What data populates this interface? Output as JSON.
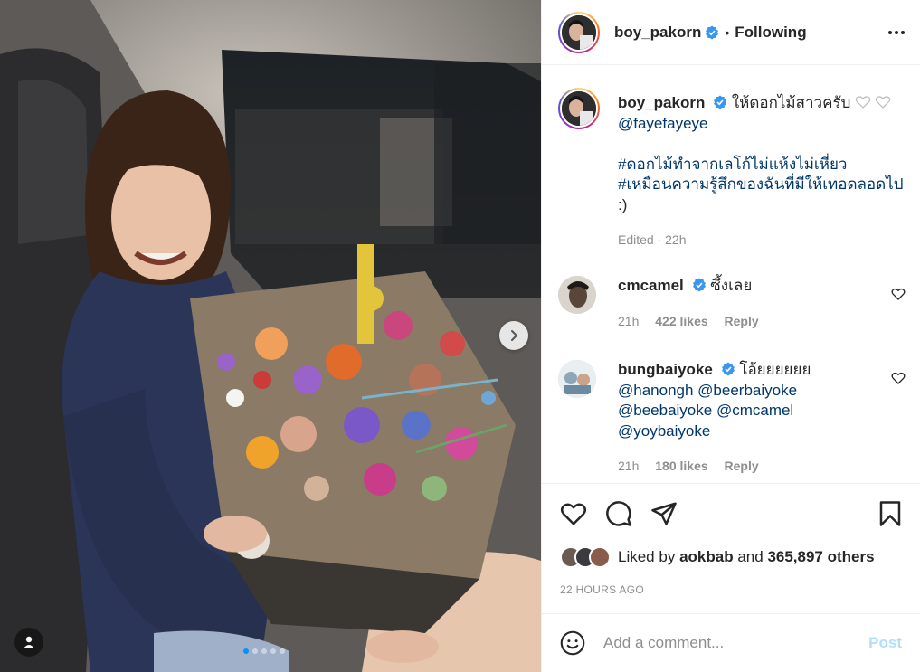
{
  "header": {
    "username": "boy_pakorn",
    "separator": "•",
    "follow_state": "Following"
  },
  "caption": {
    "username": "boy_pakorn",
    "text": "ให้ดอกไม้สาวครับ",
    "mention": "@fayefayeye",
    "hashtag_1": "#ดอกไม้ทำจากเลโก้ไม่แห้งไม่เหี่ยว",
    "hashtag_2": "#เหมือนความรู้สึกของฉันที่มีให้เทอดลอดไป",
    "emoticon": ":)",
    "meta": "Edited · 22h"
  },
  "comments": [
    {
      "username": "cmcamel",
      "text": "ซึ้งเลย",
      "time": "21h",
      "likes": "422 likes",
      "reply": "Reply"
    },
    {
      "username": "bungbaiyoke",
      "text": "โอ้ยยยยยย",
      "mentions_line_1": "@hanongh @beerbaiyoke",
      "mentions_line_2": "@beebaiyoke @cmcamel",
      "mentions_line_3": "@yoybaiyoke",
      "time": "21h",
      "likes": "180 likes",
      "reply": "Reply"
    }
  ],
  "likes": {
    "prefix": "Liked by",
    "user": "aokbab",
    "middle": "and",
    "count": "365,897 others"
  },
  "time_ago": "22 HOURS AGO",
  "add_comment": {
    "placeholder": "Add a comment...",
    "post_label": "Post"
  },
  "carousel": {
    "slides": 5,
    "active": 1
  },
  "colors": {
    "verified": "#3897f0",
    "link": "#00376b",
    "post_disabled": "#b2dffc",
    "active_dot": "#0095f6"
  },
  "icons": [
    "more-icon",
    "heart-icon",
    "comment-icon",
    "share-icon",
    "bookmark-icon",
    "emoji-icon",
    "chevron-right-icon",
    "user-tag-icon",
    "verified-icon"
  ]
}
